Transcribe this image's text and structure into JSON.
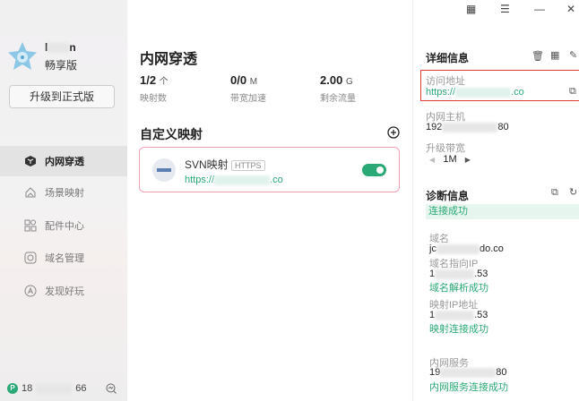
{
  "window": {
    "qr": "qr-code",
    "menu": "menu",
    "minimize": "minimize",
    "close": "close"
  },
  "user": {
    "name_start": "l",
    "name_end": "n",
    "tier": "畅享版",
    "upgrade": "升级到正式版",
    "phone_start": "18",
    "phone_end": "66"
  },
  "nav": [
    {
      "label": "内网穿透"
    },
    {
      "label": "场景映射"
    },
    {
      "label": "配件中心"
    },
    {
      "label": "域名管理"
    },
    {
      "label": "发现好玩"
    }
  ],
  "main": {
    "title": "内网穿透",
    "stats": [
      {
        "value": "1/2",
        "unit": "个",
        "label": "映射数"
      },
      {
        "value": "0/0",
        "unit": "M",
        "label": "带宽加速"
      },
      {
        "value": "2.00",
        "unit": "G",
        "label": "剩余流量"
      }
    ],
    "section": "自定义映射",
    "mapping": {
      "name": "SVN映射",
      "protocol": "HTTPS",
      "url_start": "https://",
      "url_end": ".co",
      "enabled": true
    }
  },
  "detail": {
    "title": "详细信息",
    "access_label": "访问地址",
    "access_start": "https://",
    "access_end": ".co",
    "host_label": "内网主机",
    "host_start": "192",
    "host_end": "80",
    "bw_label": "升级带宽",
    "bw_value": "1M"
  },
  "diag": {
    "title": "诊断信息",
    "status": "连接成功",
    "domain_label": "域名",
    "domain_start": "jc",
    "domain_end": "do.co",
    "dip_label": "域名指向IP",
    "dip_start": "1",
    "dip_end": ".53",
    "dip_ok": "域名解析成功",
    "mip_label": "映射IP地址",
    "mip_start": "1",
    "mip_end": ".53",
    "mip_ok": "映射连接成功",
    "svc_label": "内网服务",
    "svc_start": "19",
    "svc_end": "80",
    "svc_ok": "内网服务连接成功"
  }
}
